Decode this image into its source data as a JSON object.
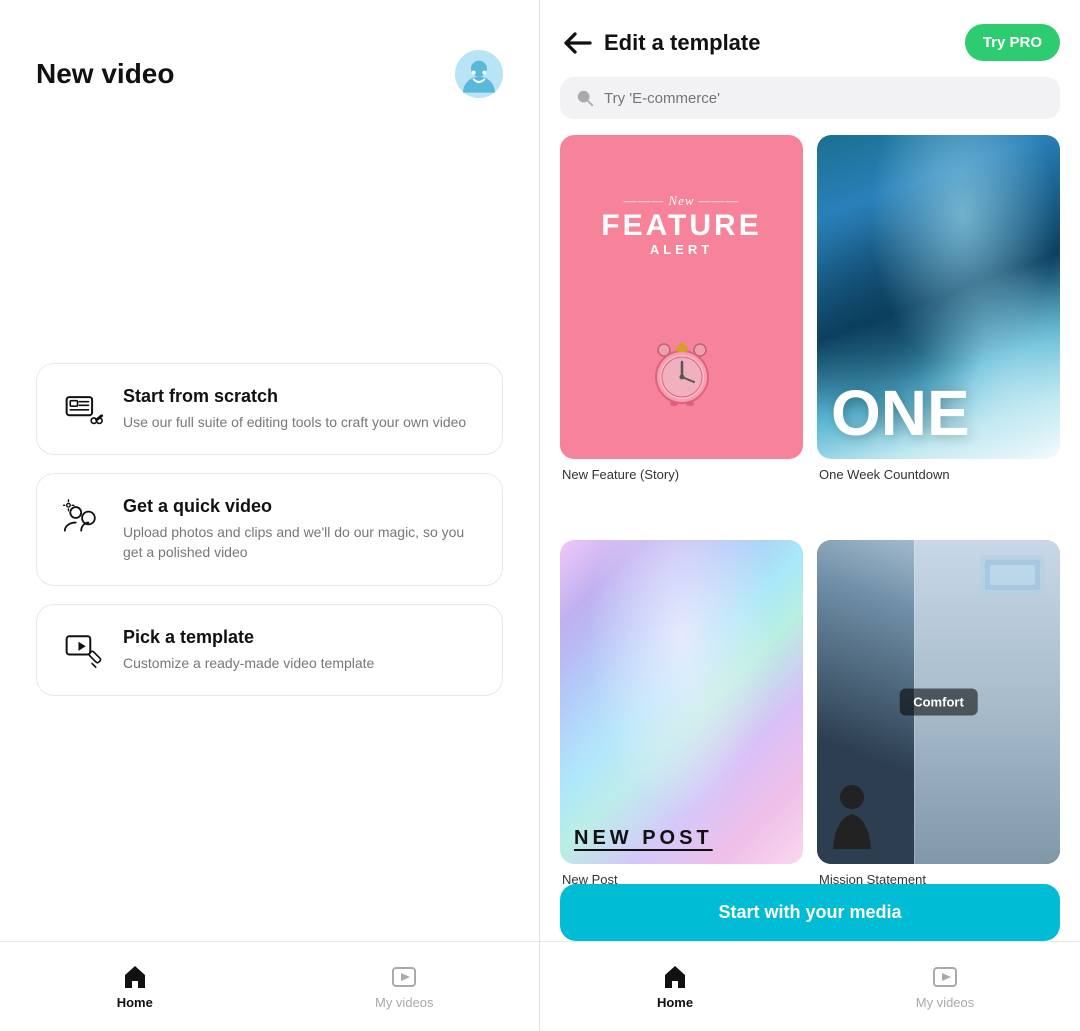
{
  "left": {
    "title": "New video",
    "options": [
      {
        "id": "scratch",
        "title": "Start from scratch",
        "desc": "Use our full suite of editing tools to craft your own video"
      },
      {
        "id": "quick",
        "title": "Get a quick video",
        "desc": "Upload photos and clips and we'll do our magic, so you get a polished video"
      },
      {
        "id": "template",
        "title": "Pick a template",
        "desc": "Customize a ready-made video template"
      }
    ],
    "nav": {
      "home_label": "Home",
      "myvideos_label": "My videos"
    }
  },
  "right": {
    "title": "Edit a template",
    "try_pro_label": "Try PRO",
    "search_placeholder": "Try 'E-commerce'",
    "templates": [
      {
        "id": "new-feature",
        "label": "New Feature (Story)",
        "style": "pink"
      },
      {
        "id": "one-week",
        "label": "One Week Countdown",
        "style": "ocean"
      },
      {
        "id": "new-post",
        "label": "New Post",
        "style": "holo"
      },
      {
        "id": "mission",
        "label": "Mission Statement",
        "style": "car"
      }
    ],
    "comfort_badge": "Comfort",
    "feature_new": "New",
    "feature_main": "FEATURE",
    "feature_alert": "ALERT",
    "one_text": "ONE",
    "new_post_text": "NEW POST",
    "start_media_label": "Start with your media",
    "nav": {
      "home_label": "Home",
      "myvideos_label": "My videos"
    }
  }
}
